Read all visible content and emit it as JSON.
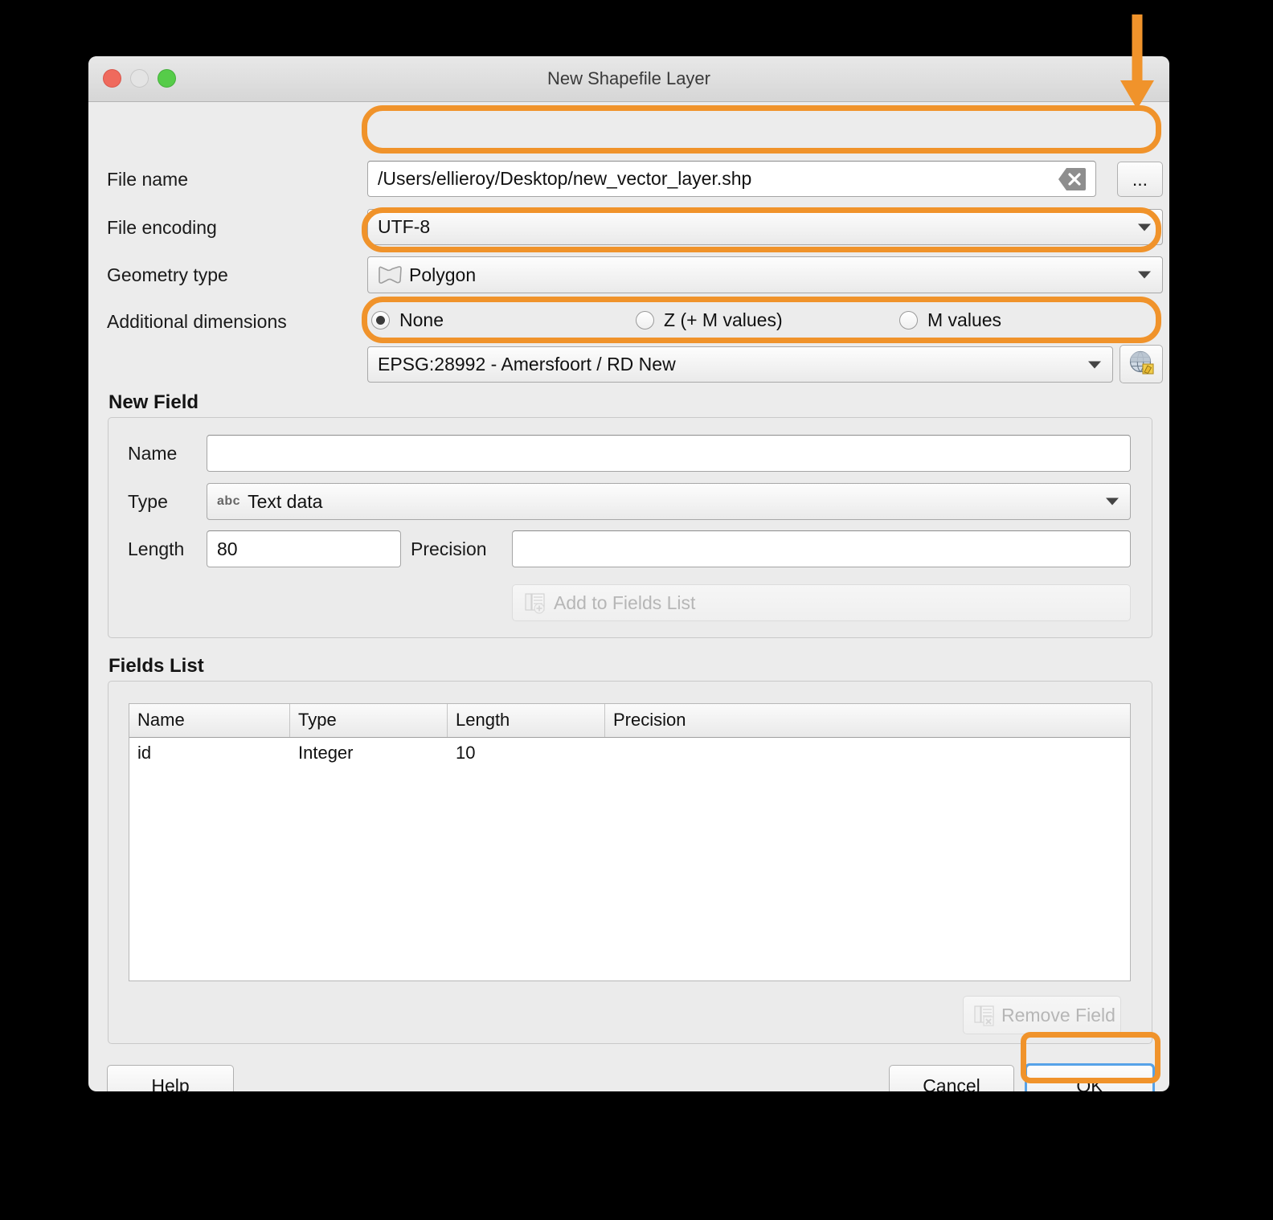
{
  "window": {
    "title": "New Shapefile Layer",
    "traffic_lights": [
      "close",
      "minimize",
      "maximize"
    ]
  },
  "form": {
    "file_name": {
      "label": "File name",
      "value": "/Users/ellieroy/Desktop/new_vector_layer.shp",
      "clear_icon": "clear-x-icon",
      "browse_label": "..."
    },
    "file_encoding": {
      "label": "File encoding",
      "value": "UTF-8"
    },
    "geometry_type": {
      "label": "Geometry type",
      "value": "Polygon",
      "icon": "polygon-icon"
    },
    "additional_dimensions": {
      "label": "Additional dimensions",
      "options": [
        {
          "label": "None",
          "selected": true
        },
        {
          "label": "Z (+ M values)",
          "selected": false
        },
        {
          "label": "M values",
          "selected": false
        }
      ]
    },
    "crs": {
      "value": "EPSG:28992 - Amersfoort / RD New",
      "select_icon": "globe-crs-icon"
    }
  },
  "new_field": {
    "title": "New Field",
    "name_label": "Name",
    "name_value": "",
    "type_label": "Type",
    "type_value": "Text data",
    "type_icon": "abc-text-icon",
    "length_label": "Length",
    "length_value": "80",
    "precision_label": "Precision",
    "precision_value": "",
    "add_button": "Add to Fields List",
    "add_button_icon": "add-field-icon"
  },
  "fields_list": {
    "title": "Fields List",
    "columns": [
      "Name",
      "Type",
      "Length",
      "Precision"
    ],
    "rows": [
      {
        "name": "id",
        "type": "Integer",
        "length": "10",
        "precision": ""
      }
    ],
    "remove_button": "Remove Field",
    "remove_button_icon": "remove-field-icon"
  },
  "footer": {
    "help": "Help",
    "cancel": "Cancel",
    "ok": "OK"
  },
  "annotations": {
    "accent_color": "#f0932b",
    "focus_color": "#56a2e8",
    "arrow": "down-arrow-annotation",
    "highlighted": [
      "file-name-field",
      "geometry-type-combo",
      "crs-combo",
      "ok-button"
    ]
  }
}
